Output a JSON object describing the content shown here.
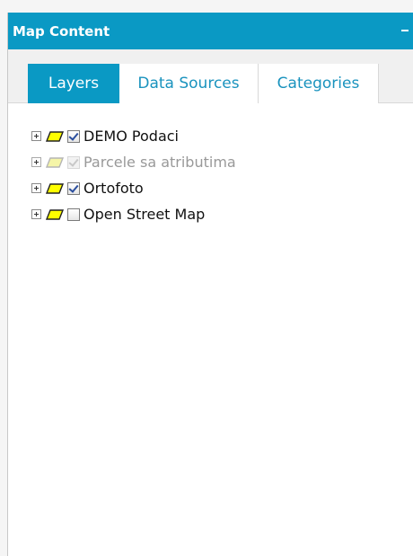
{
  "panel": {
    "title": "Map Content",
    "header_color": "#0a99c4"
  },
  "tabs": [
    {
      "label": "Layers",
      "active": true
    },
    {
      "label": "Data Sources",
      "active": false
    },
    {
      "label": "Categories",
      "active": false
    }
  ],
  "layers": [
    {
      "label": "DEMO Podaci",
      "checked": true,
      "enabled": true,
      "icon": "polygon-layer-icon"
    },
    {
      "label": "Parcele sa atributima",
      "checked": true,
      "enabled": false,
      "icon": "polygon-layer-icon"
    },
    {
      "label": "Ortofoto",
      "checked": true,
      "enabled": true,
      "icon": "polygon-layer-icon"
    },
    {
      "label": "Open Street Map",
      "checked": false,
      "enabled": true,
      "icon": "polygon-layer-icon"
    }
  ],
  "colors": {
    "accent": "#0a99c4",
    "tab_text": "#1a93be",
    "layer_icon_fill": "#ffff00",
    "layer_icon_fill_disabled": "#f5f5a8"
  }
}
